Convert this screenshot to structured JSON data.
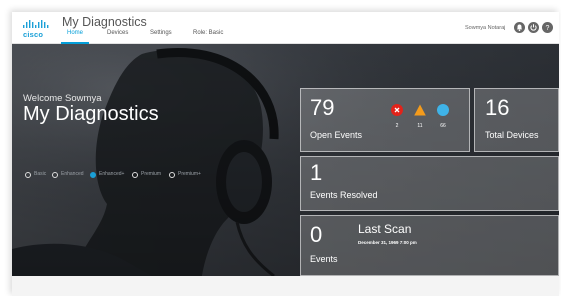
{
  "app": {
    "title": "My Diagnostics",
    "logo_word": "cisco"
  },
  "nav": {
    "items": [
      {
        "label": "Home",
        "active": true
      },
      {
        "label": "Devices",
        "active": false
      },
      {
        "label": "Settings",
        "active": false
      },
      {
        "label": "Role: Basic",
        "active": false
      }
    ]
  },
  "user": {
    "name": "Sowmya Notaraj",
    "buttons": [
      "bell-icon",
      "power-icon",
      "help-icon"
    ]
  },
  "hero": {
    "welcome": "Welcome Sowmya",
    "title": "My Diagnostics",
    "levels": [
      {
        "label": "Basic",
        "selected": false
      },
      {
        "label": "Enhanced",
        "selected": false
      },
      {
        "label": "Enhanced+",
        "selected": true
      },
      {
        "label": "Premium",
        "selected": false
      },
      {
        "label": "Premium+",
        "selected": false
      }
    ]
  },
  "tiles": {
    "open_events": {
      "value": "79",
      "caption": "Open Events",
      "severities": [
        {
          "icon": "critical-icon",
          "count": "2",
          "color": "#e2231a"
        },
        {
          "icon": "warning-icon",
          "count": "11",
          "color": "#f49b1c"
        },
        {
          "icon": "info-icon",
          "count": "66",
          "color": "#3fb3e8"
        }
      ]
    },
    "total_devices": {
      "value": "16",
      "caption": "Total Devices"
    },
    "events_resolved": {
      "value": "1",
      "caption": "Events Resolved"
    },
    "last_scan": {
      "value": "0",
      "caption": "Events",
      "title": "Last Scan",
      "date": "December 31, 1969 7:00 pm"
    }
  }
}
